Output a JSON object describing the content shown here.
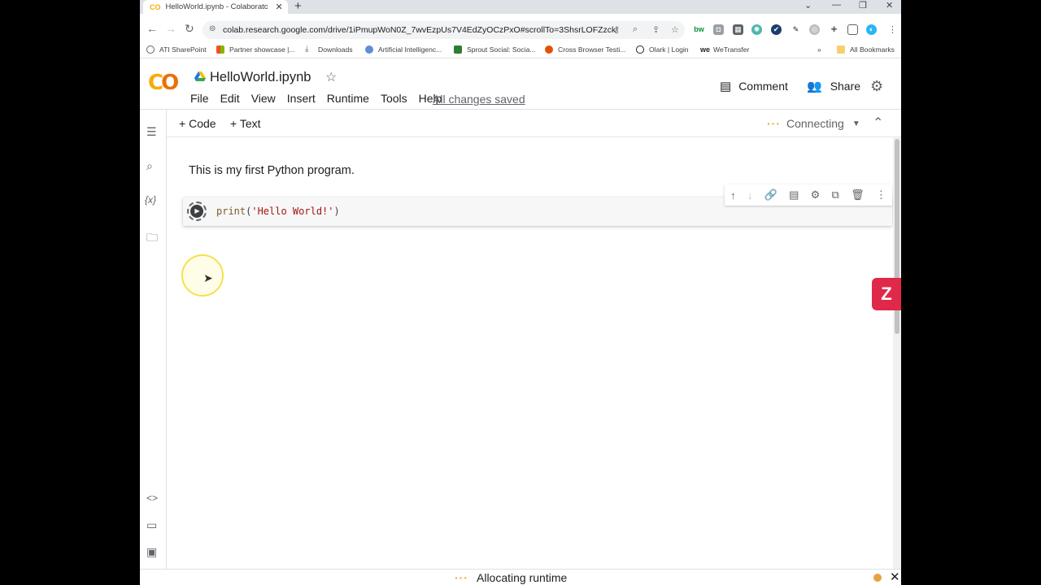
{
  "browser": {
    "tab_title": "HelloWorld.ipynb - Colaboratory",
    "url": "colab.research.google.com/drive/1iPmupWoN0Z_7wvEzpUs7V4EdZyOCzPxO#scrollTo=3ShsrLOFZzck"
  },
  "bookmarks": [
    "ATI SharePoint",
    "Partner showcase |...",
    "Downloads",
    "Artificial Intelligenc...",
    "Sprout Social: Socia...",
    "Cross Browser Testi...",
    "Olark | Login",
    "WeTransfer",
    "All Bookmarks"
  ],
  "header": {
    "notebook_title": "HelloWorld.ipynb",
    "menu": [
      "File",
      "Edit",
      "View",
      "Insert",
      "Runtime",
      "Tools",
      "Help"
    ],
    "save_status": "All changes saved",
    "comment_label": "Comment",
    "share_label": "Share"
  },
  "toolbar": {
    "add_code": "Code",
    "add_text": "Text",
    "connection_status": "Connecting"
  },
  "cells": {
    "text": "This is my first Python program.",
    "code_fn": "print",
    "code_arg": "'Hello World!'"
  },
  "status": {
    "text": "Allocating runtime"
  },
  "colors": {
    "colab_orange": "#f9ab00",
    "status_dot": "#e8a33d",
    "zoom_button": "#e0284a"
  }
}
